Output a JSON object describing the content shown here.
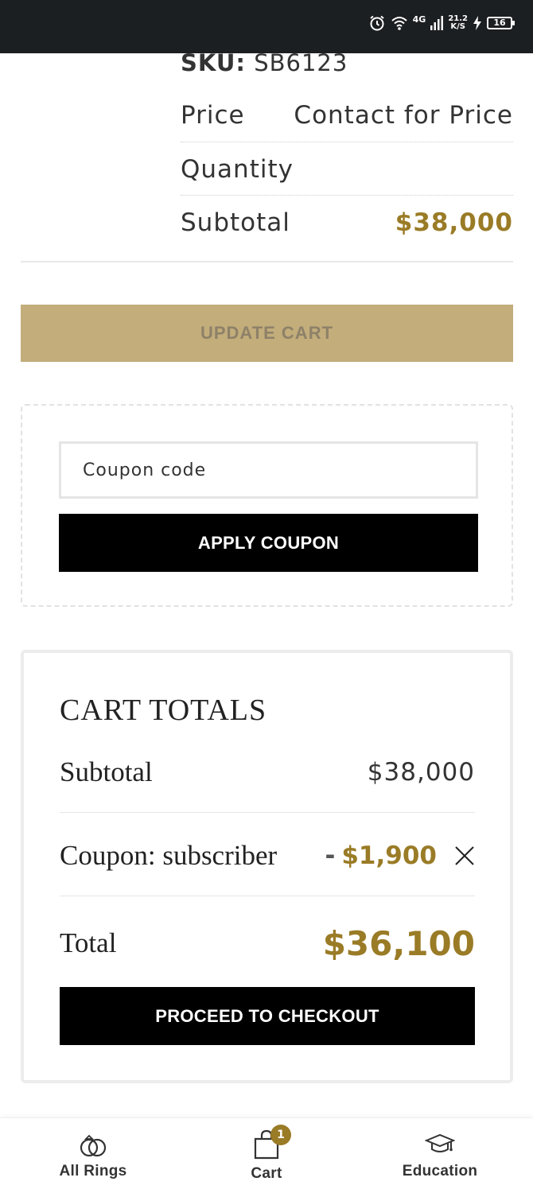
{
  "status_bar": {
    "network": "4G",
    "speed_value": "21.2",
    "speed_unit": "K/S",
    "battery": "16"
  },
  "product": {
    "sku_label": "SKU:",
    "sku_value": "SB6123",
    "price_label": "Price",
    "price_value": "Contact for Price",
    "quantity_label": "Quantity",
    "subtotal_label": "Subtotal",
    "subtotal_value": "$38,000"
  },
  "update_cart_label": "UPDATE CART",
  "coupon": {
    "placeholder": "Coupon code",
    "apply_label": "APPLY COUPON"
  },
  "cart_totals": {
    "title": "CART TOTALS",
    "subtotal_label": "Subtotal",
    "subtotal_value": "$38,000",
    "coupon_label": "Coupon: subscriber",
    "coupon_dash": "-",
    "coupon_value": "$1,900",
    "total_label": "Total",
    "total_value": "$36,100",
    "checkout_label": "PROCEED TO CHECKOUT"
  },
  "bottom_nav": {
    "items": [
      {
        "label": "All Rings",
        "icon": "rings-icon"
      },
      {
        "label": "Cart",
        "icon": "shopping-bag-icon",
        "badge": "1"
      },
      {
        "label": "Education",
        "icon": "graduation-cap-icon"
      }
    ]
  },
  "colors": {
    "accent_gold": "#9a7b26",
    "update_button": "#c2ad7b",
    "status_bar": "#1c1f22"
  }
}
